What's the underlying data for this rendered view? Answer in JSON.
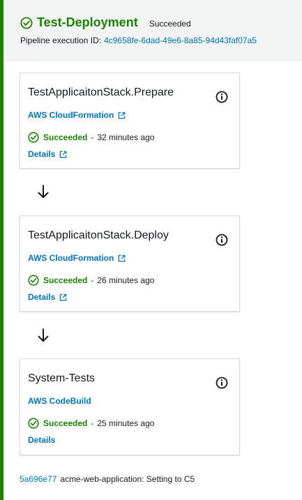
{
  "stage": {
    "title": "Test-Deployment",
    "status": "Succeeded",
    "exec_label": "Pipeline execution ID:",
    "exec_id": "4c9658fe-6dad-49e6-8a85-94d43faf07a5"
  },
  "actions": [
    {
      "name": "TestApplicaitonStack.Prepare",
      "provider": "AWS CloudFormation",
      "status": "Succeeded",
      "separator": "-",
      "time": "32 minutes ago",
      "details": "Details"
    },
    {
      "name": "TestApplicaitonStack.Deploy",
      "provider": "AWS CloudFormation",
      "status": "Succeeded",
      "separator": "-",
      "time": "26 minutes ago",
      "details": "Details"
    },
    {
      "name": "System-Tests",
      "provider": "AWS CodeBuild",
      "status": "Succeeded",
      "separator": "-",
      "time": "25 minutes ago",
      "details": "Details"
    }
  ],
  "commit": {
    "id": "5a696e77",
    "message": "acme-web-application: Setting to C5"
  },
  "icons": {
    "success": "check-circle-icon",
    "info": "info-circle-icon",
    "external": "external-link-icon",
    "arrow": "arrow-down-icon"
  },
  "colors": {
    "success": "#1d8102",
    "link": "#0073bb",
    "header_bg": "#f2f3f3",
    "text": "#16191f"
  }
}
